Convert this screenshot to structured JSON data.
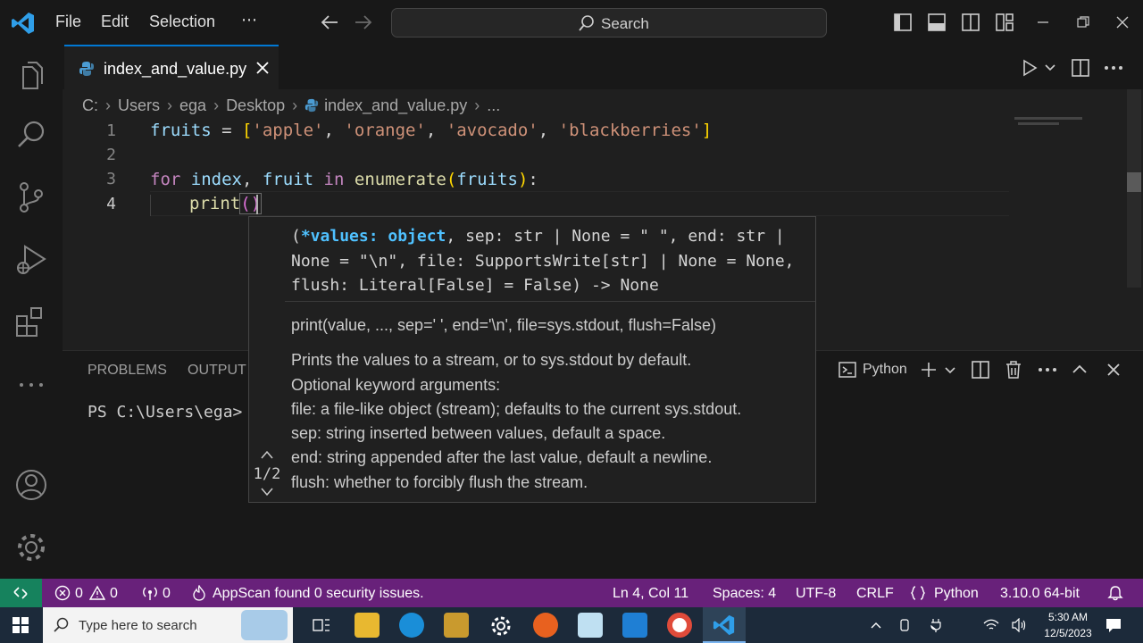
{
  "menu": [
    "File",
    "Edit",
    "Selection",
    "⋯"
  ],
  "search": {
    "label": "Search"
  },
  "tab": {
    "filename": "index_and_value.py"
  },
  "breadcrumb": [
    "C:",
    "Users",
    "ega",
    "Desktop",
    "index_and_value.py",
    "..."
  ],
  "editor": {
    "line_numbers": [
      "1",
      "2",
      "3",
      "4"
    ],
    "line1": {
      "var": "fruits",
      "eq": " = ",
      "open": "[",
      "s1": "'apple'",
      "c": ", ",
      "s2": "'orange'",
      "s3": "'avocado'",
      "s4": "'blackberries'",
      "close": "]"
    },
    "line3": {
      "kw1": "for",
      "v1": "index",
      "comma": ",",
      "v2": "fruit",
      "kw2": "in",
      "fn": "enumerate",
      "open": "(",
      "arg": "fruits",
      "close": ")",
      "colon": ":"
    },
    "line4": {
      "fn": "print",
      "parens": "()"
    }
  },
  "hover": {
    "sig_open": "(",
    "sig_active": "*values: object",
    "sig_rest1": ", sep: str | None = \" \", end: str |",
    "sig_line2": "None = \"\\n\", file: SupportsWrite[str] | None = None,",
    "sig_line3": "flush: Literal[False] = False) -> None",
    "doc_signature": "print(value, ..., sep=' ', end='\\n', file=sys.stdout, flush=False)",
    "doc_lines": [
      "Prints the values to a stream, or to sys.stdout by default.",
      "Optional keyword arguments:",
      "file: a file-like object (stream); defaults to the current sys.stdout.",
      "sep: string inserted between values, default a space.",
      "end: string appended after the last value, default a newline.",
      "flush: whether to forcibly flush the stream."
    ],
    "counter": "1/2"
  },
  "panel": {
    "tabs": [
      "PROBLEMS",
      "OUTPUT"
    ],
    "terminal_name": "Python",
    "prompt": "PS C:\\Users\\ega>"
  },
  "status": {
    "errors": "0",
    "warnings": "0",
    "ports": "0",
    "appscan": "AppScan found 0 security issues.",
    "position": "Ln 4, Col 11",
    "spaces": "Spaces: 4",
    "encoding": "UTF-8",
    "eol": "CRLF",
    "language": "Python",
    "interpreter": "3.10.0 64-bit"
  },
  "taskbar": {
    "search_placeholder": "Type here to search",
    "time": "5:30 AM",
    "date": "12/5/2023"
  },
  "colors": {
    "accent": "#0078d4",
    "statusbar": "#68217a",
    "remote": "#16825d"
  }
}
